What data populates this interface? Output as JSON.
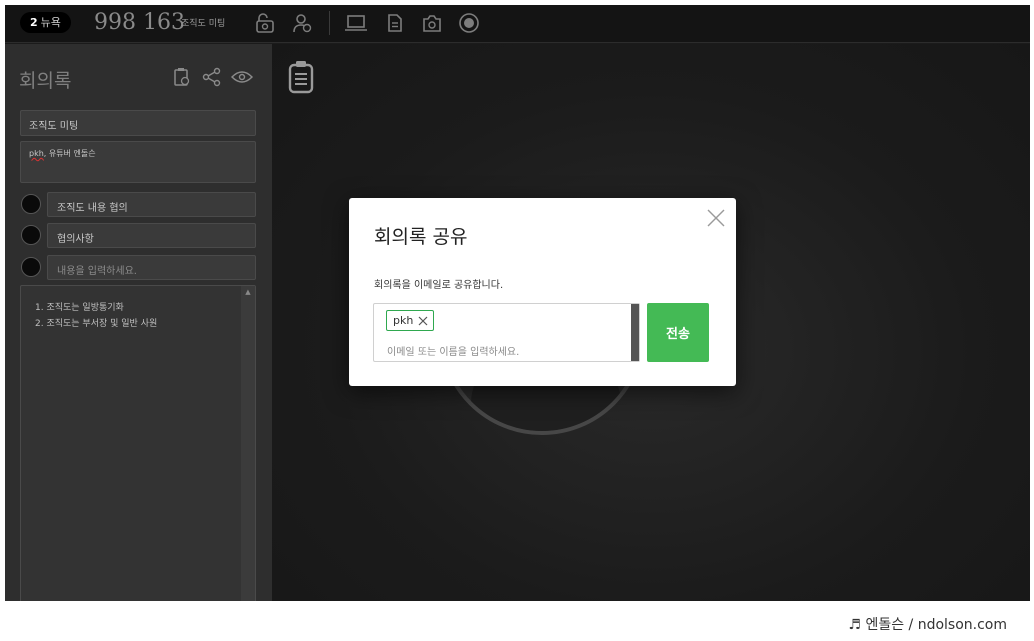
{
  "topbar": {
    "count": "2",
    "count_label": "뉴욕",
    "room_number": "998 163",
    "room_title": "조직도 미팅",
    "icons": [
      "unlock-camera-icon",
      "add-user-icon",
      "screen-share-icon",
      "document-icon",
      "camera-icon",
      "record-icon"
    ]
  },
  "sidepanel": {
    "title": "회의록",
    "meeting_title": "조직도 미팅",
    "participants_name": "pkh",
    "participants_rest": ", 유튜버 엔돌슨",
    "agenda": [
      {
        "label": "조직도 내용 협의"
      },
      {
        "label": "협의사항"
      },
      {
        "label": "내용을 입력하세요."
      }
    ],
    "notes": [
      "1. 조직도는 일방통기화",
      "2. 조직도는 부서장 및 일반 사원"
    ]
  },
  "modal": {
    "title": "회의록 공유",
    "description": "회의록을 이메일로 공유합니다.",
    "chip_label": "pkh",
    "input_placeholder": "이메일 또는 이름을 입력하세요.",
    "send_label": "전송"
  },
  "colors": {
    "accent_green": "#44ba55",
    "chip_border": "#2fa84f"
  },
  "watermark": "♬ 엔돌슨 / ndolson.com"
}
